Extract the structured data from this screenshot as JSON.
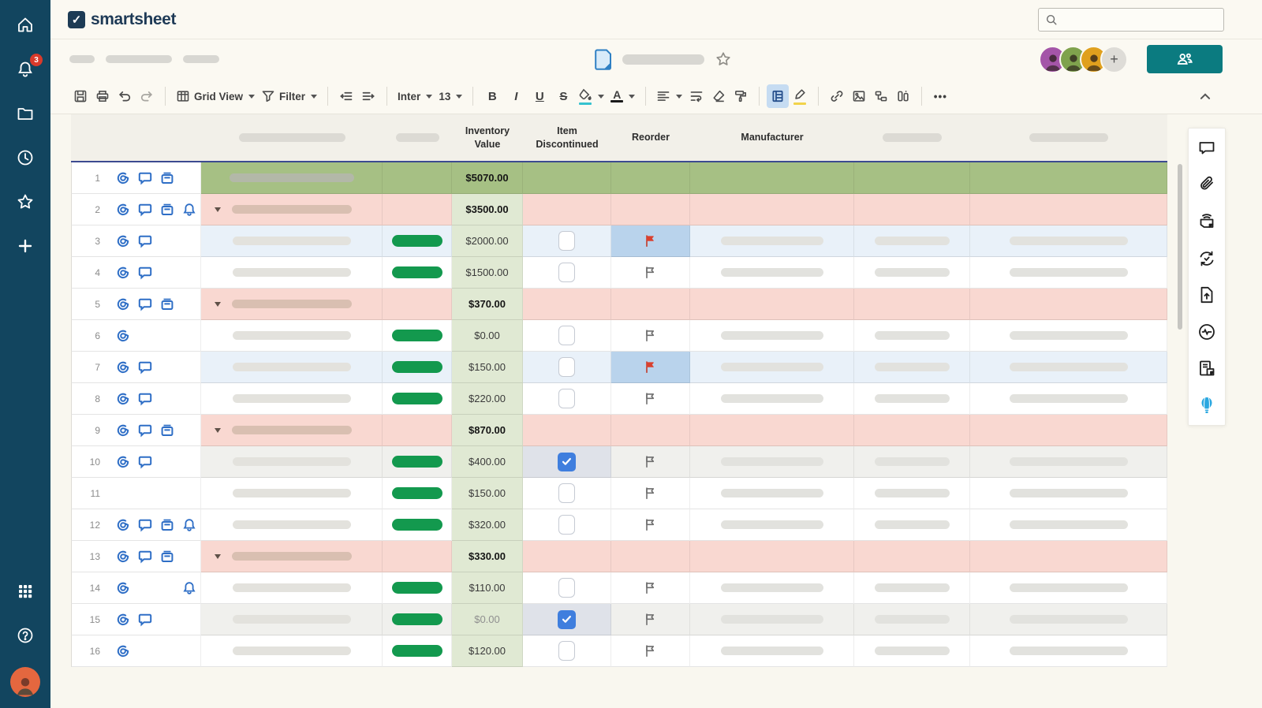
{
  "app": {
    "logo_text": "smartsheet"
  },
  "sidebar": {
    "notification_count": "3",
    "top_icons": [
      "home",
      "notifications",
      "browse",
      "recents",
      "favorites",
      "create"
    ],
    "bottom_icons": [
      "apps",
      "help",
      "account"
    ]
  },
  "header": {
    "search_placeholder": "",
    "collaborators": [
      {
        "name": "collaborator-1",
        "color": "#a455a8"
      },
      {
        "name": "collaborator-2",
        "color": "#7fa24d"
      },
      {
        "name": "collaborator-3",
        "color": "#e0a01e"
      }
    ],
    "add_collaborator_label": "+",
    "share_icon": "share-people-icon"
  },
  "toolbar": {
    "view_label": "Grid View",
    "filter_label": "Filter",
    "font_name": "Inter",
    "font_size": "13",
    "bold_label": "B",
    "italic_label": "I",
    "underline_label": "U",
    "strikethrough_label": "S",
    "text_color_label": "A",
    "more_label": "•••",
    "icons": [
      "save",
      "print",
      "undo",
      "redo",
      "grid-view",
      "filter",
      "outdent",
      "indent",
      "bold",
      "italic",
      "underline",
      "strikethrough",
      "fill-color",
      "text-color",
      "align-left",
      "wrap-text",
      "clear-format",
      "format-painter",
      "card-view",
      "highlight",
      "link",
      "image",
      "hierarchy",
      "cell-linking",
      "more-options",
      "collapse-toolbar"
    ]
  },
  "colors": {
    "sidebar": "#12455f",
    "share_button": "#0b7b80",
    "row_total": "#a6c084",
    "row_parent_pink": "#f9d8d1",
    "row_highlight_blue": "#e9f1f9",
    "row_checked_gray": "#f0f0ed",
    "inventory_column": "#e0e9d3",
    "reorder_highlight_cell": "#b9d3ec",
    "status_pill": "#13994e",
    "checkbox_checked": "#3f7ede",
    "flag_red": "#d9402e",
    "notification_badge": "#d93a2b",
    "active_tool_chip": "#c6dcf2",
    "highlighter_yellow": "#f2d34b",
    "fill_swatch_teal": "#35c2cf",
    "whats_new_balloon": "#2aa7e0"
  },
  "grid": {
    "columns": [
      {
        "name": "row-header",
        "label": "",
        "placeholder": false
      },
      {
        "name": "primary",
        "label": "",
        "placeholder": true,
        "pill_w": 135
      },
      {
        "name": "status",
        "label": "",
        "placeholder": true,
        "pill_w": 55
      },
      {
        "name": "inventory-value",
        "label": "Inventory Value",
        "placeholder": false
      },
      {
        "name": "item-discontinued",
        "label": "Item Discontinued",
        "placeholder": false
      },
      {
        "name": "reorder",
        "label": "Reorder",
        "placeholder": false
      },
      {
        "name": "manufacturer",
        "label": "Manufacturer",
        "placeholder": false
      },
      {
        "name": "extra-1",
        "label": "",
        "placeholder": true,
        "pill_w": 75
      },
      {
        "name": "extra-2",
        "label": "",
        "placeholder": true,
        "pill_w": 100
      }
    ],
    "rows": [
      {
        "num": "1",
        "kind": "total",
        "icons": [
          "attachment",
          "comment",
          "proof"
        ],
        "value": "$5070.00",
        "checkbox": null,
        "flag": null,
        "status": false
      },
      {
        "num": "2",
        "kind": "parent",
        "icons": [
          "attachment",
          "comment",
          "proof",
          "bell"
        ],
        "value": "$3500.00",
        "checkbox": null,
        "flag": null,
        "status": false
      },
      {
        "num": "3",
        "kind": "child",
        "bg": "blue",
        "icons": [
          "attachment",
          "comment"
        ],
        "value": "$2000.00",
        "checkbox": "unchecked",
        "flag": "red",
        "status": true
      },
      {
        "num": "4",
        "kind": "child",
        "bg": "white",
        "icons": [
          "attachment",
          "comment"
        ],
        "value": "$1500.00",
        "checkbox": "unchecked",
        "flag": "gray",
        "status": true
      },
      {
        "num": "5",
        "kind": "parent",
        "icons": [
          "attachment",
          "comment",
          "proof"
        ],
        "value": "$370.00",
        "checkbox": null,
        "flag": null,
        "status": false
      },
      {
        "num": "6",
        "kind": "child",
        "bg": "white",
        "icons": [
          "attachment"
        ],
        "value": "$0.00",
        "checkbox": "unchecked",
        "flag": "gray",
        "status": true
      },
      {
        "num": "7",
        "kind": "child",
        "bg": "blue",
        "icons": [
          "attachment",
          "comment"
        ],
        "value": "$150.00",
        "checkbox": "unchecked",
        "flag": "red",
        "status": true
      },
      {
        "num": "8",
        "kind": "child",
        "bg": "white",
        "icons": [
          "attachment",
          "comment"
        ],
        "value": "$220.00",
        "checkbox": "unchecked",
        "flag": "gray",
        "status": true
      },
      {
        "num": "9",
        "kind": "parent",
        "icons": [
          "attachment",
          "comment",
          "proof"
        ],
        "value": "$870.00",
        "checkbox": null,
        "flag": null,
        "status": false
      },
      {
        "num": "10",
        "kind": "child",
        "bg": "gray",
        "icons": [
          "attachment",
          "comment"
        ],
        "value": "$400.00",
        "checkbox": "checked",
        "flag": "gray",
        "status": true
      },
      {
        "num": "11",
        "kind": "child",
        "bg": "white",
        "icons": [],
        "value": "$150.00",
        "checkbox": "unchecked",
        "flag": "gray",
        "status": true
      },
      {
        "num": "12",
        "kind": "child",
        "bg": "white",
        "icons": [
          "attachment",
          "comment",
          "proof",
          "bell"
        ],
        "value": "$320.00",
        "checkbox": "unchecked",
        "flag": "gray",
        "status": true
      },
      {
        "num": "13",
        "kind": "parent",
        "icons": [
          "attachment",
          "comment",
          "proof"
        ],
        "value": "$330.00",
        "checkbox": null,
        "flag": null,
        "status": false
      },
      {
        "num": "14",
        "kind": "child",
        "bg": "white",
        "icons": [
          "attachment",
          null,
          null,
          "bell"
        ],
        "value": "$110.00",
        "checkbox": "unchecked",
        "flag": "gray",
        "status": true
      },
      {
        "num": "15",
        "kind": "child",
        "bg": "gray",
        "icons": [
          "attachment",
          "comment"
        ],
        "value": "$0.00",
        "muted": true,
        "checkbox": "checked",
        "flag": "gray",
        "status": true
      },
      {
        "num": "16",
        "kind": "child",
        "bg": "white",
        "icons": [
          "attachment"
        ],
        "value": "$120.00",
        "checkbox": "unchecked",
        "flag": "gray",
        "status": true
      }
    ]
  },
  "right_panel": {
    "icons": [
      "conversations",
      "attachments",
      "proofs",
      "update-requests",
      "publish",
      "activity-log",
      "sheet-summary",
      "whats-new"
    ]
  }
}
